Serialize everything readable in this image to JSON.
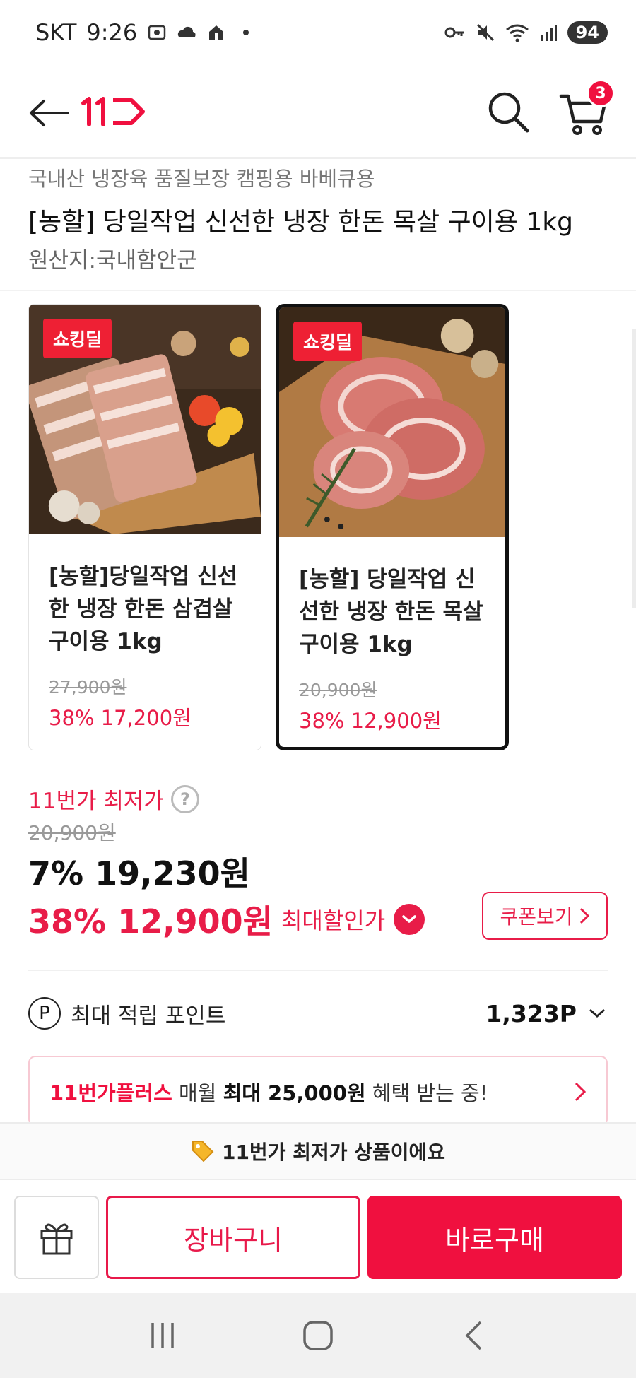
{
  "status_bar": {
    "carrier": "SKT",
    "time": "9:26",
    "battery": "94"
  },
  "header": {
    "logo": "11st",
    "cart_count": "3"
  },
  "product": {
    "tagline": "국내산 냉장육 품질보장 캠핑용 바베큐용",
    "title": "[농할] 당일작업 신선한 냉장 한돈 목살 구이용 1kg",
    "origin": "원산지:국내함안군"
  },
  "options": [
    {
      "badge": "쇼킹딜",
      "name": "[농할]당일작업 신선한 냉장 한돈 삼겹살 구이용 1kg",
      "original_price": "27,900원",
      "discount_price": "38% 17,200원",
      "selected": false
    },
    {
      "badge": "쇼킹딜",
      "name": "[농할] 당일작업 신선한 냉장 한돈 목살 구이용 1kg",
      "original_price": "20,900원",
      "discount_price": "38% 12,900원",
      "selected": true
    }
  ],
  "pricing": {
    "lowest_label": "11번가 최저가",
    "help": "?",
    "original": "20,900원",
    "price1": "7% 19,230원",
    "price2": "38% 12,900원",
    "max_label": "최대할인가",
    "coupon_button": "쿠폰보기"
  },
  "points": {
    "icon_letter": "P",
    "label": "최대 적립 포인트",
    "value": "1,323P"
  },
  "plus_banner": {
    "brand": "11번가플러스",
    "text1": "매월",
    "strong": "최대 25,000원",
    "text2": "혜택 받는 중!"
  },
  "notice": {
    "text": "11번가 최저가 상품이에요"
  },
  "actions": {
    "cart": "장바구니",
    "buy": "바로구매"
  },
  "colors": {
    "brand": "#f0103f",
    "price_red": "#e81c48"
  }
}
